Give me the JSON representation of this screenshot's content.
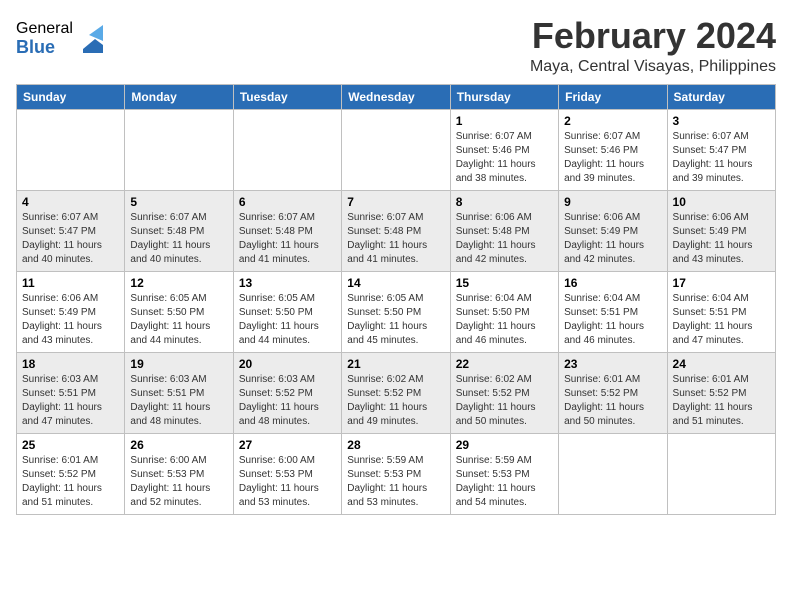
{
  "logo": {
    "general": "General",
    "blue": "Blue"
  },
  "title": {
    "month": "February 2024",
    "location": "Maya, Central Visayas, Philippines"
  },
  "headers": [
    "Sunday",
    "Monday",
    "Tuesday",
    "Wednesday",
    "Thursday",
    "Friday",
    "Saturday"
  ],
  "weeks": [
    [
      {
        "day": "",
        "info": ""
      },
      {
        "day": "",
        "info": ""
      },
      {
        "day": "",
        "info": ""
      },
      {
        "day": "",
        "info": ""
      },
      {
        "day": "1",
        "info": "Sunrise: 6:07 AM\nSunset: 5:46 PM\nDaylight: 11 hours\nand 38 minutes."
      },
      {
        "day": "2",
        "info": "Sunrise: 6:07 AM\nSunset: 5:46 PM\nDaylight: 11 hours\nand 39 minutes."
      },
      {
        "day": "3",
        "info": "Sunrise: 6:07 AM\nSunset: 5:47 PM\nDaylight: 11 hours\nand 39 minutes."
      }
    ],
    [
      {
        "day": "4",
        "info": "Sunrise: 6:07 AM\nSunset: 5:47 PM\nDaylight: 11 hours\nand 40 minutes."
      },
      {
        "day": "5",
        "info": "Sunrise: 6:07 AM\nSunset: 5:48 PM\nDaylight: 11 hours\nand 40 minutes."
      },
      {
        "day": "6",
        "info": "Sunrise: 6:07 AM\nSunset: 5:48 PM\nDaylight: 11 hours\nand 41 minutes."
      },
      {
        "day": "7",
        "info": "Sunrise: 6:07 AM\nSunset: 5:48 PM\nDaylight: 11 hours\nand 41 minutes."
      },
      {
        "day": "8",
        "info": "Sunrise: 6:06 AM\nSunset: 5:48 PM\nDaylight: 11 hours\nand 42 minutes."
      },
      {
        "day": "9",
        "info": "Sunrise: 6:06 AM\nSunset: 5:49 PM\nDaylight: 11 hours\nand 42 minutes."
      },
      {
        "day": "10",
        "info": "Sunrise: 6:06 AM\nSunset: 5:49 PM\nDaylight: 11 hours\nand 43 minutes."
      }
    ],
    [
      {
        "day": "11",
        "info": "Sunrise: 6:06 AM\nSunset: 5:49 PM\nDaylight: 11 hours\nand 43 minutes."
      },
      {
        "day": "12",
        "info": "Sunrise: 6:05 AM\nSunset: 5:50 PM\nDaylight: 11 hours\nand 44 minutes."
      },
      {
        "day": "13",
        "info": "Sunrise: 6:05 AM\nSunset: 5:50 PM\nDaylight: 11 hours\nand 44 minutes."
      },
      {
        "day": "14",
        "info": "Sunrise: 6:05 AM\nSunset: 5:50 PM\nDaylight: 11 hours\nand 45 minutes."
      },
      {
        "day": "15",
        "info": "Sunrise: 6:04 AM\nSunset: 5:50 PM\nDaylight: 11 hours\nand 46 minutes."
      },
      {
        "day": "16",
        "info": "Sunrise: 6:04 AM\nSunset: 5:51 PM\nDaylight: 11 hours\nand 46 minutes."
      },
      {
        "day": "17",
        "info": "Sunrise: 6:04 AM\nSunset: 5:51 PM\nDaylight: 11 hours\nand 47 minutes."
      }
    ],
    [
      {
        "day": "18",
        "info": "Sunrise: 6:03 AM\nSunset: 5:51 PM\nDaylight: 11 hours\nand 47 minutes."
      },
      {
        "day": "19",
        "info": "Sunrise: 6:03 AM\nSunset: 5:51 PM\nDaylight: 11 hours\nand 48 minutes."
      },
      {
        "day": "20",
        "info": "Sunrise: 6:03 AM\nSunset: 5:52 PM\nDaylight: 11 hours\nand 48 minutes."
      },
      {
        "day": "21",
        "info": "Sunrise: 6:02 AM\nSunset: 5:52 PM\nDaylight: 11 hours\nand 49 minutes."
      },
      {
        "day": "22",
        "info": "Sunrise: 6:02 AM\nSunset: 5:52 PM\nDaylight: 11 hours\nand 50 minutes."
      },
      {
        "day": "23",
        "info": "Sunrise: 6:01 AM\nSunset: 5:52 PM\nDaylight: 11 hours\nand 50 minutes."
      },
      {
        "day": "24",
        "info": "Sunrise: 6:01 AM\nSunset: 5:52 PM\nDaylight: 11 hours\nand 51 minutes."
      }
    ],
    [
      {
        "day": "25",
        "info": "Sunrise: 6:01 AM\nSunset: 5:52 PM\nDaylight: 11 hours\nand 51 minutes."
      },
      {
        "day": "26",
        "info": "Sunrise: 6:00 AM\nSunset: 5:53 PM\nDaylight: 11 hours\nand 52 minutes."
      },
      {
        "day": "27",
        "info": "Sunrise: 6:00 AM\nSunset: 5:53 PM\nDaylight: 11 hours\nand 53 minutes."
      },
      {
        "day": "28",
        "info": "Sunrise: 5:59 AM\nSunset: 5:53 PM\nDaylight: 11 hours\nand 53 minutes."
      },
      {
        "day": "29",
        "info": "Sunrise: 5:59 AM\nSunset: 5:53 PM\nDaylight: 11 hours\nand 54 minutes."
      },
      {
        "day": "",
        "info": ""
      },
      {
        "day": "",
        "info": ""
      }
    ]
  ]
}
